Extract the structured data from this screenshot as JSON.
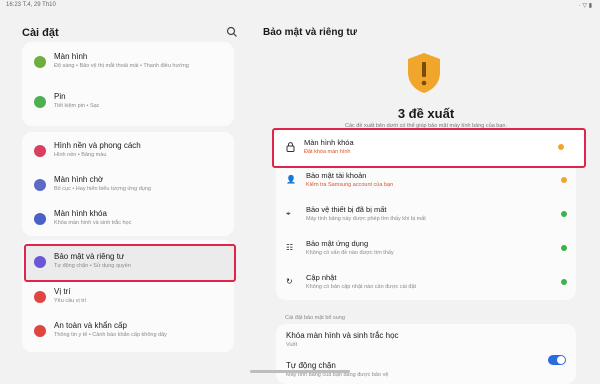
{
  "status": {
    "time": "16:23",
    "date": "T.4, 29 Th10",
    "right_icons": "· ▽ ▮"
  },
  "left": {
    "title": "Cài đặt",
    "items": [
      {
        "title": "Màn hình",
        "subtitle": "Độ sáng  •  Bảo vệ thị mắt thoải mái  •  Thanh điều hướng",
        "color": "#6fae3d"
      },
      {
        "title": "Pin",
        "subtitle": "Tiết kiệm pin  •  Sạc",
        "color": "#4caf50"
      },
      {
        "title": "Hình nền và phong cách",
        "subtitle": "Hình nền  •  Bảng màu",
        "color": "#d9405e"
      },
      {
        "title": "Màn hình chờ",
        "subtitle": "Bố cục  •  Hay hiển biểu tượng ứng dụng",
        "color": "#5a6bc6"
      },
      {
        "title": "Màn hình khóa",
        "subtitle": "Khóa màn hình và sinh trắc học",
        "color": "#4a62c8"
      },
      {
        "title": "Bảo mật và riêng tư",
        "subtitle": "Tự động chặn  •  Sử dụng quyền",
        "color": "#6a56d6"
      },
      {
        "title": "Vị trí",
        "subtitle": "Yêu cầu vị trí",
        "color": "#e0453f"
      },
      {
        "title": "An toàn và khẩn cấp",
        "subtitle": "Thông tin y tế  •  Cảnh báo khẩn cấp không dây",
        "color": "#e0453f"
      }
    ]
  },
  "right": {
    "title": "Bảo mật và riêng tư",
    "count": "3 đề xuất",
    "description": "Các đề xuất bên dưới có thể giúp bảo mật máy tính bảng của bạn.",
    "items": [
      {
        "title": "Màn hình khóa",
        "subtitle": "Đặt khóa màn hình",
        "status": "orange",
        "icon": "🔒"
      },
      {
        "title": "Bảo mật tài khoản",
        "subtitle": "Kiểm tra Samsung account của bạn",
        "status": "orange",
        "icon": "👤"
      },
      {
        "title": "Bảo vệ thiết bị đã bị mất",
        "subtitle": "Máy tính bảng này được phép tìm thấy khi bị mất",
        "status": "green",
        "icon": "⌖"
      },
      {
        "title": "Bảo mật ứng dụng",
        "subtitle": "Không có vấn đề nào được tìm thấy",
        "status": "green",
        "icon": "☷"
      },
      {
        "title": "Cập nhật",
        "subtitle": "Không có bản cập nhật nào cần được cài đặt",
        "status": "green",
        "icon": "↻"
      }
    ],
    "additional_label": "Cài đặt bảo mật bổ sung",
    "extra": [
      {
        "title": "Khóa màn hình và sinh trắc học",
        "subtitle": "Vuốt"
      },
      {
        "title": "Tự động chặn",
        "subtitle": "Máy tính bảng của bạn đang được bảo vệ"
      }
    ],
    "auto_block_on": true
  },
  "colors": {
    "highlight": "#e0244a",
    "warning": "#f0a62a",
    "ok": "#3cb34a",
    "shield": "#f0a62a"
  }
}
